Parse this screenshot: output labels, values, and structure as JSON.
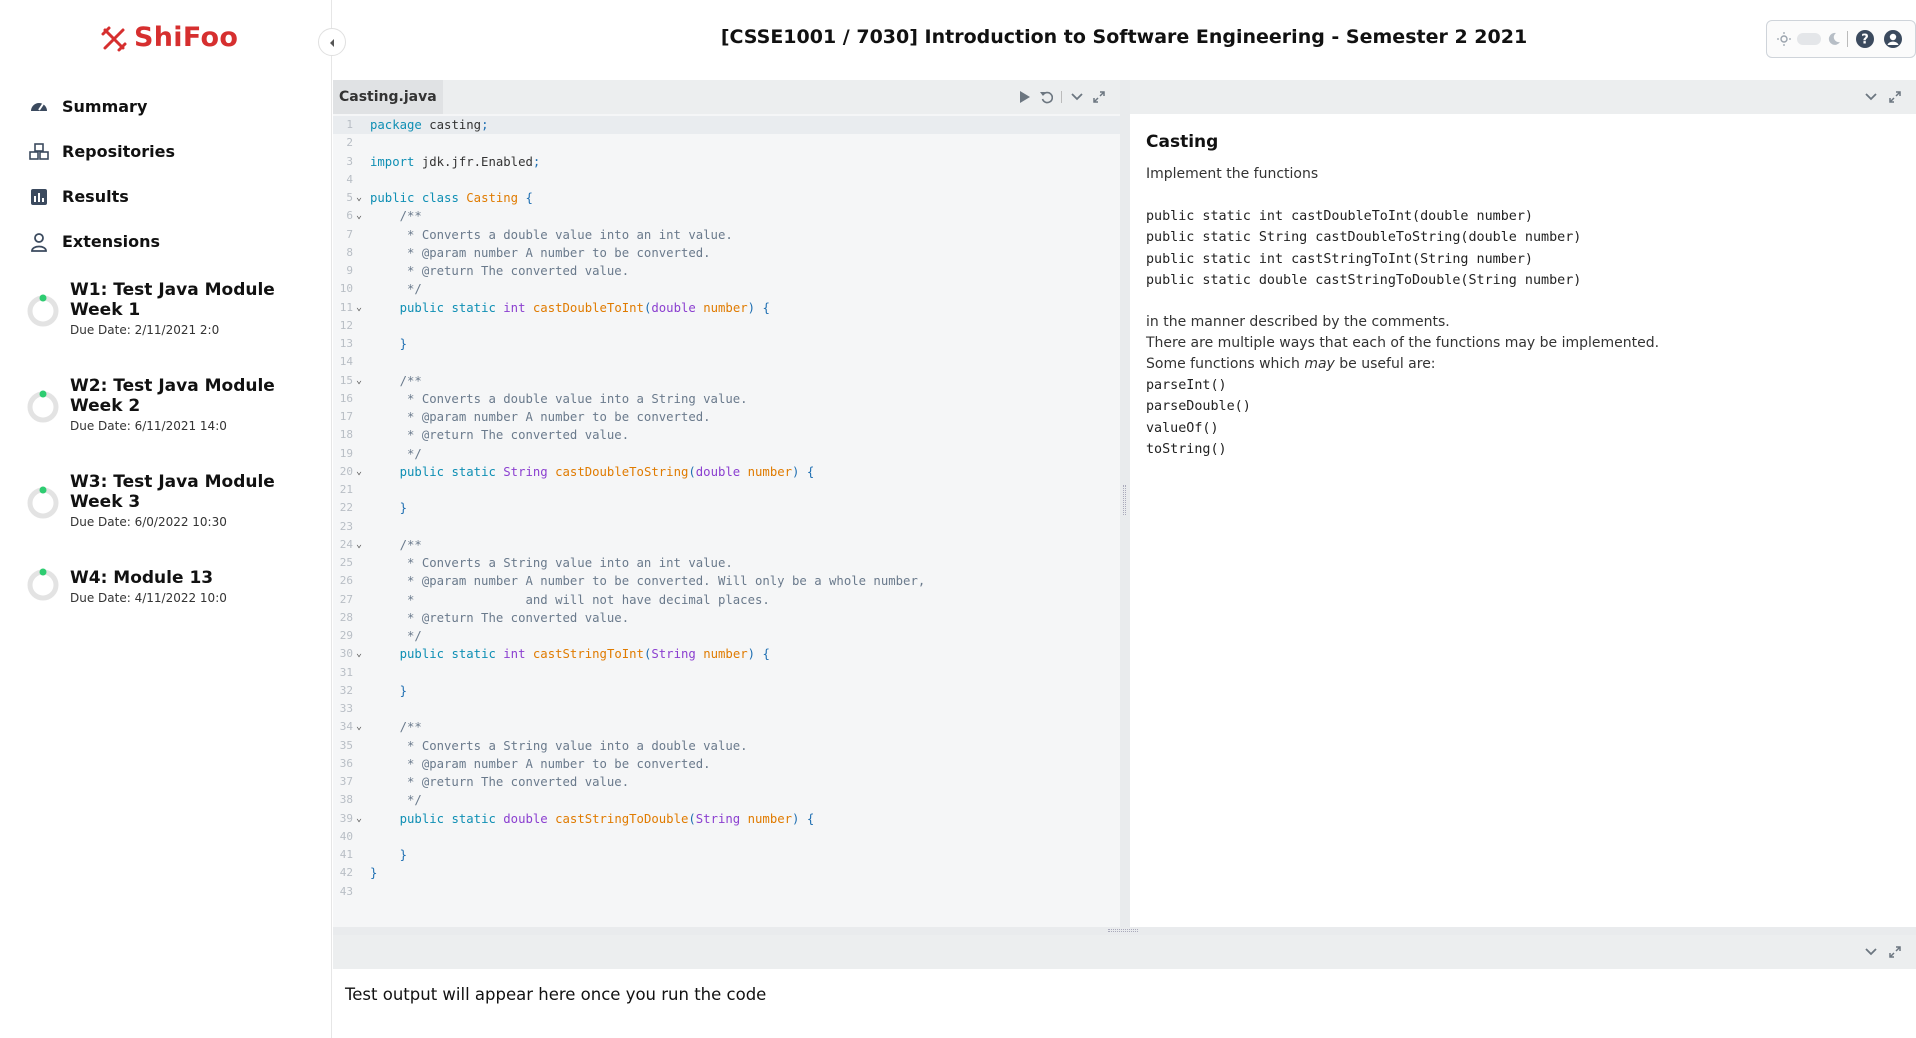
{
  "app": {
    "brand": "ShiFoo",
    "page_title": "[CSSE1001 / 7030] Introduction to Software Engineering - Semester 2 2021"
  },
  "colors": {
    "brand": "#d62f2f",
    "progress": "#2ecc71",
    "keyword": "#0f8fb4",
    "type": "#8b3fd0",
    "function": "#e07b00",
    "comment": "#6a7a8c"
  },
  "sidebar": {
    "nav": [
      {
        "label": "Summary",
        "icon": "gauge-icon"
      },
      {
        "label": "Repositories",
        "icon": "cubes-icon"
      },
      {
        "label": "Results",
        "icon": "bar-chart-icon"
      },
      {
        "label": "Extensions",
        "icon": "user-icon"
      }
    ],
    "modules": [
      {
        "title": "W1: Test Java Module Week 1",
        "due": "Due Date: 2/11/2021 2:0"
      },
      {
        "title": "W2: Test Java Module Week 2",
        "due": "Due Date: 6/11/2021 14:0"
      },
      {
        "title": "W3: Test Java Module Week 3",
        "due": "Due Date: 6/0/2022 10:30"
      },
      {
        "title": "W4: Module 13",
        "due": "Due Date: 4/11/2022 10:0"
      }
    ]
  },
  "editor": {
    "file_name": "Casting.java",
    "lines": [
      "package casting;",
      "",
      "import jdk.jfr.Enabled;",
      "",
      "public class Casting {",
      "    /**",
      "     * Converts a double value into an int value.",
      "     * @param number A number to be converted.",
      "     * @return The converted value.",
      "     */",
      "    public static int castDoubleToInt(double number) {",
      "",
      "    }",
      "",
      "    /**",
      "     * Converts a double value into a String value.",
      "     * @param number A number to be converted.",
      "     * @return The converted value.",
      "     */",
      "    public static String castDoubleToString(double number) {",
      "",
      "    }",
      "",
      "    /**",
      "     * Converts a String value into an int value.",
      "     * @param number A number to be converted. Will only be a whole number,",
      "     *               and will not have decimal places.",
      "     * @return The converted value.",
      "     */",
      "    public static int castStringToInt(String number) {",
      "",
      "    }",
      "",
      "    /**",
      "     * Converts a String value into a double value.",
      "     * @param number A number to be converted.",
      "     * @return The converted value.",
      "     */",
      "    public static double castStringToDouble(String number) {",
      "",
      "    }",
      "}",
      ""
    ],
    "fold_lines": [
      5,
      6,
      11,
      15,
      20,
      24,
      30,
      34,
      39
    ]
  },
  "description": {
    "title": "Casting",
    "intro": "Implement the functions",
    "signatures": [
      "public static int castDoubleToInt(double number)",
      "public static String castDoubleToString(double number)",
      "public static int castStringToInt(String number)",
      "public static double castStringToDouble(String number)"
    ],
    "p1": "in the manner described by the comments.",
    "p2": "There are multiple ways that each of the functions may be implemented.",
    "p3_before": "Some functions which ",
    "p3_em": "may",
    "p3_after": " be useful are:",
    "useful": [
      "parseInt()",
      "parseDouble()",
      "valueOf()",
      "toString()"
    ]
  },
  "output": {
    "text": "Test output will appear here once you run the code"
  }
}
